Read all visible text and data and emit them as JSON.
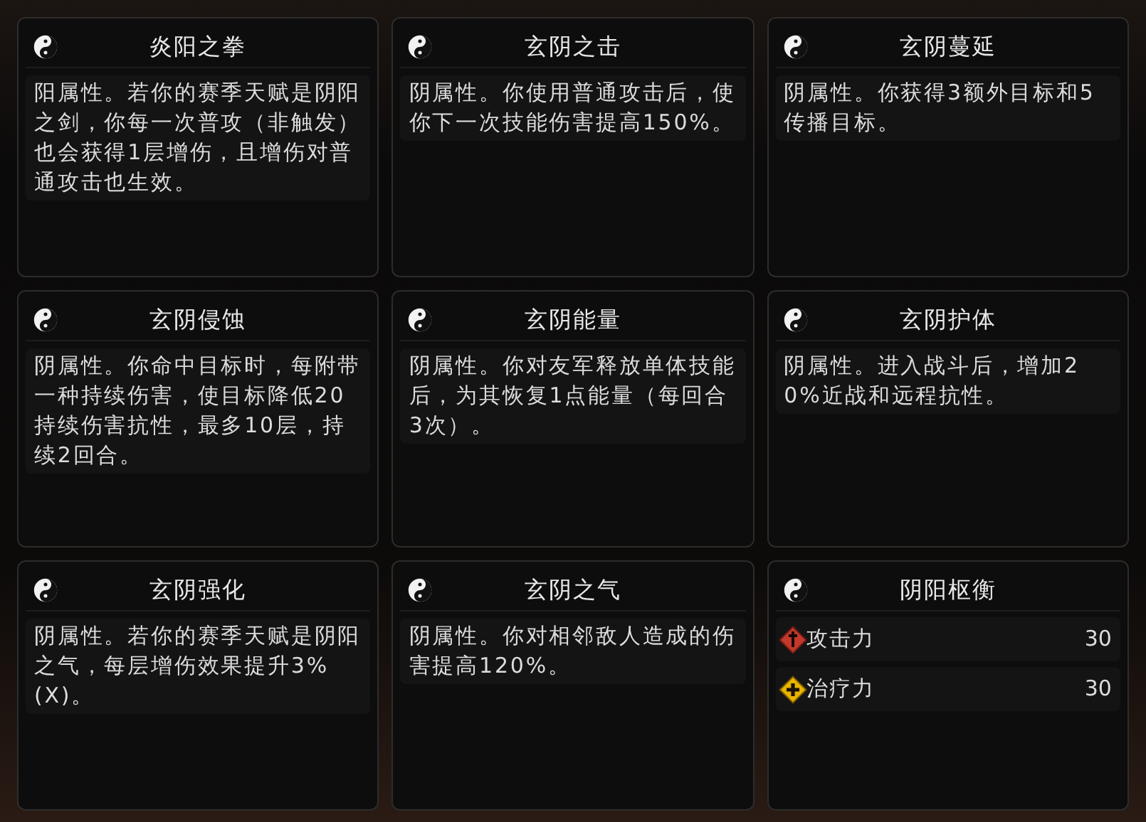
{
  "cards": [
    {
      "kind": "description",
      "title": "炎阳之拳",
      "text": "阳属性。若你的赛季天赋是阴阳之剑，你每一次普攻（非触发）也会获得1层增伤，且增伤对普通攻击也生效。"
    },
    {
      "kind": "description",
      "title": "玄阴之击",
      "text": "阴属性。你使用普通攻击后，使你下一次技能伤害提高150%。"
    },
    {
      "kind": "description",
      "title": "玄阴蔓延",
      "text": "阴属性。你获得3额外目标和5传播目标。"
    },
    {
      "kind": "description",
      "title": "玄阴侵蚀",
      "text": "阴属性。你命中目标时，每附带一种持续伤害，使目标降低20持续伤害抗性，最多10层，持续2回合。"
    },
    {
      "kind": "description",
      "title": "玄阴能量",
      "text": "阴属性。你对友军释放单体技能后，为其恢复1点能量（每回合3次）。"
    },
    {
      "kind": "description",
      "title": "玄阴护体",
      "text": "阴属性。进入战斗后，增加20%近战和远程抗性。"
    },
    {
      "kind": "description",
      "title": "玄阴强化",
      "text": "阴属性。若你的赛季天赋是阴阳之气，每层增伤效果提升3%(X)。"
    },
    {
      "kind": "description",
      "title": "玄阴之气",
      "text": "阴属性。你对相邻敌人造成的伤害提高120%。"
    },
    {
      "kind": "stats",
      "title": "阴阳枢衡",
      "stats": [
        {
          "kind": "attack",
          "label": "攻击力",
          "value": "30"
        },
        {
          "kind": "heal",
          "label": "治疗力",
          "value": "30"
        }
      ]
    }
  ]
}
